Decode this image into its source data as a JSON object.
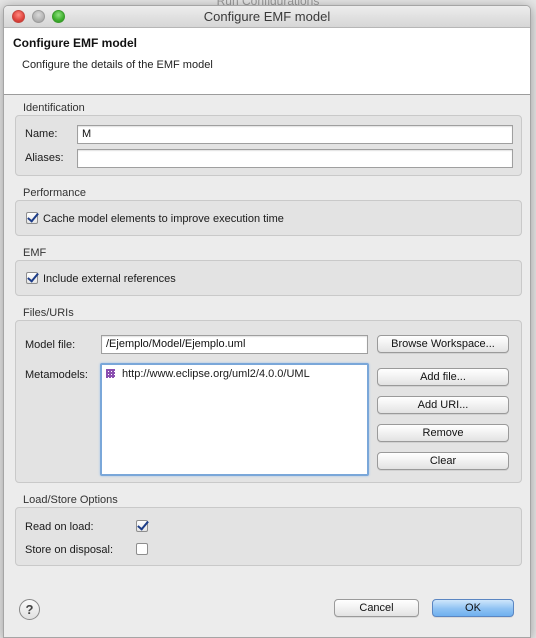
{
  "background": {
    "window_title": "Run Configurations"
  },
  "dialog": {
    "title": "Configure EMF model",
    "header_title": "Configure EMF model",
    "header_description": "Configure the details of the EMF model"
  },
  "identification": {
    "section_label": "Identification",
    "name_label": "Name:",
    "name_value": "M",
    "aliases_label": "Aliases:",
    "aliases_value": ""
  },
  "performance": {
    "section_label": "Performance",
    "cache_label": "Cache model elements to improve execution time",
    "cache_checked": true
  },
  "emf": {
    "section_label": "EMF",
    "include_label": "Include external references",
    "include_checked": true
  },
  "files": {
    "section_label": "Files/URIs",
    "model_file_label": "Model file:",
    "model_file_value": "/Ejemplo/Model/Ejemplo.uml",
    "browse_label": "Browse Workspace...",
    "metamodels_label": "Metamodels:",
    "metamodels": [
      "http://www.eclipse.org/uml2/4.0.0/UML"
    ],
    "add_file_label": "Add file...",
    "add_uri_label": "Add URI...",
    "remove_label": "Remove",
    "clear_label": "Clear"
  },
  "load_store": {
    "section_label": "Load/Store Options",
    "read_on_load_label": "Read on load:",
    "read_on_load_checked": true,
    "store_on_disposal_label": "Store on disposal:",
    "store_on_disposal_checked": false
  },
  "footer": {
    "help_symbol": "?",
    "cancel_label": "Cancel",
    "ok_label": "OK"
  },
  "colors": {
    "accent": "#6fb0ef",
    "check": "#1d3d88",
    "package_icon": "#8a4fb0"
  }
}
